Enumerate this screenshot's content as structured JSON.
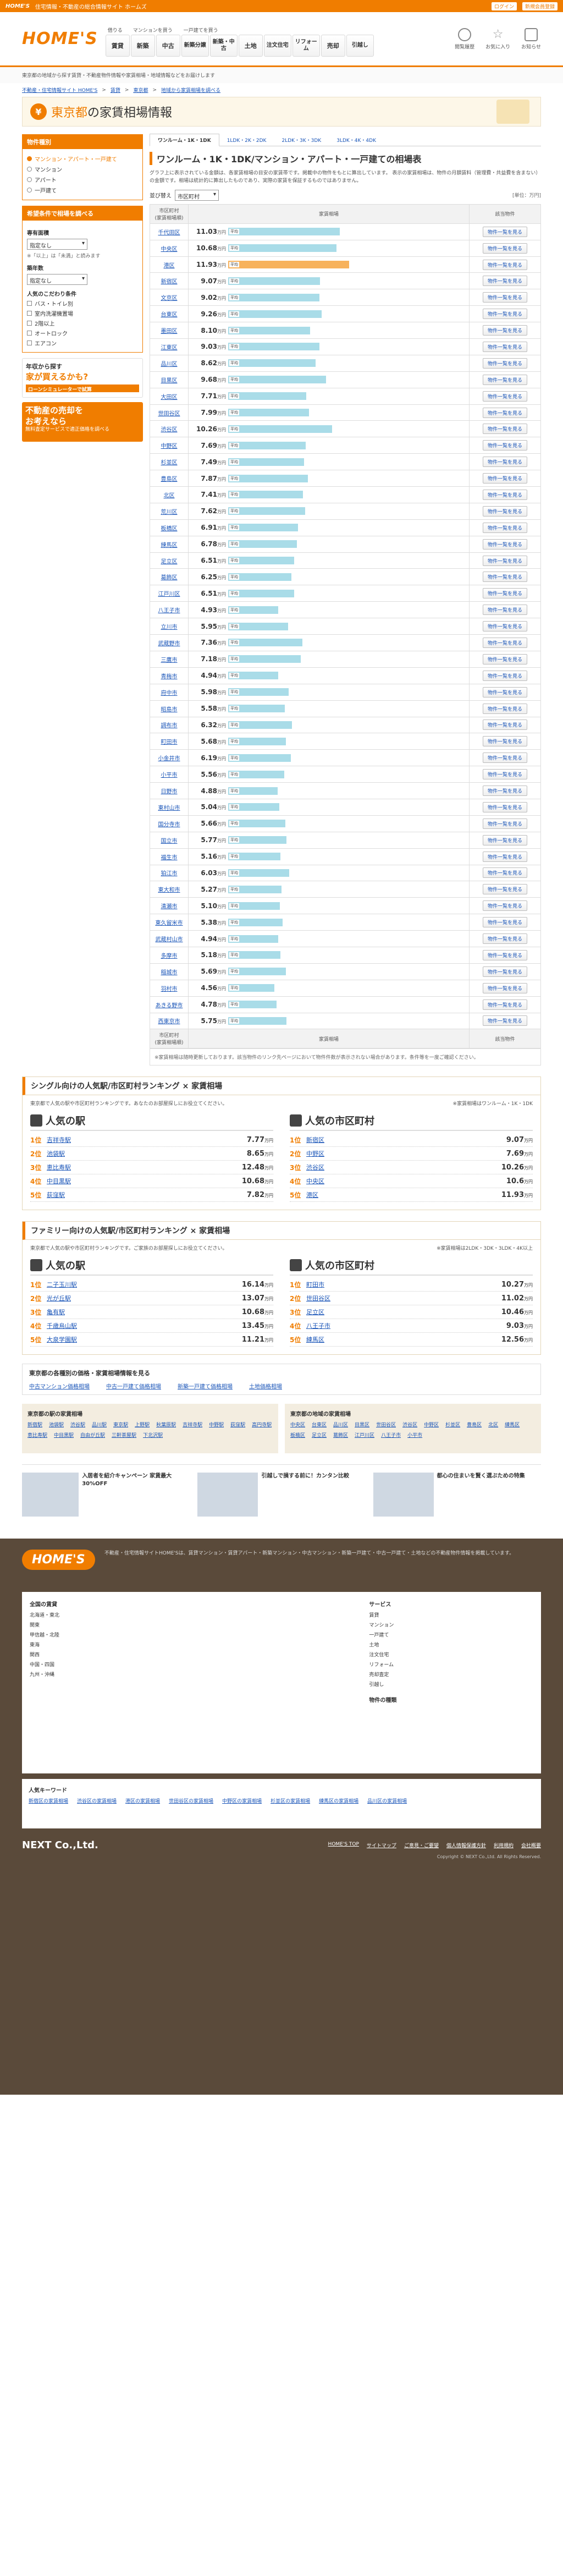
{
  "topbar": {
    "brand": "HOME'S",
    "tagline": "住宅情報・不動産の総合情報サイト ホームズ",
    "login": "ログイン",
    "register": "新規会員登録"
  },
  "header": {
    "logo": "HOME'S",
    "groups": [
      {
        "caption": "借りる",
        "buttons": [
          "賃貸"
        ]
      },
      {
        "caption": "マンションを買う",
        "buttons": [
          "新築",
          "中古"
        ]
      },
      {
        "caption": "一戸建てを買う",
        "buttons": [
          "新築分譲",
          "新築・中古"
        ]
      },
      {
        "caption": "",
        "buttons": [
          "土地",
          "注文住宅",
          "リフォーム",
          "売却",
          "引越し"
        ]
      }
    ],
    "icons": [
      "閲覧履歴",
      "お気に入り",
      "お知らせ"
    ]
  },
  "breadcrumb": "東京都の地域から探す賃貸・不動産物件情報や家賃相場・地域情報などをお届けします",
  "crumbs": [
    "不動産・住宅情報サイト HOME'S",
    "賃貸",
    "東京都",
    "地域から家賃相場を調べる"
  ],
  "title": {
    "pre": "東京都",
    "post": "の家賃相場情報",
    "icon": "¥"
  },
  "sidebar": {
    "box1": {
      "head": "物件種別",
      "items": [
        "マンション・アパート・一戸建て",
        "マンション",
        "アパート",
        "一戸建て"
      ],
      "selected": 0
    },
    "box2": {
      "head": "希望条件で相場を調べる",
      "madori_label": "専有面積",
      "madori_val": "指定なし",
      "note": "※「以上」は「未満」と読みます",
      "chiku_label": "築年数",
      "chiku_val": "指定なし",
      "pop_label": "人気のこだわり条件",
      "conds": [
        "バス・トイレ別",
        "室内洗濯機置場",
        "2階以上",
        "オートロック",
        "エアコン"
      ]
    },
    "promo1": {
      "top": "年収から探す",
      "big": "家が買えるかも?",
      "bar": "ローンシミュレーターで試算"
    },
    "promo2": {
      "line1": "不動産の売却を",
      "line2": "お考えなら",
      "small": "無料査定サービスで適正価格を調べる"
    }
  },
  "main": {
    "tabs": [
      "ワンルーム・1K・1DK",
      "1LDK・2K・2DK",
      "2LDK・3K・3DK",
      "3LDK・4K・4DK"
    ],
    "page_title": "ワンルーム・1K・1DK/マンション・アパート・一戸建ての相場表",
    "desc": "グラフ上に表示されている金額は、各家賃相場の目安の家賃帯です。掲載中の物件をもとに算出しています。\n表示の家賃相場は、物件の月額賃料（管理費・共益費を含まない）の金額です。相場は統計的に算出したものであり、実際の家賃を保証するものではありません。",
    "sort_label": "並び替え",
    "sort_val": "市区町村",
    "unit_note": "[単位：万円]",
    "col_city": "市区町村",
    "col_city_sub": "(家賃相場順)",
    "col_val": "家賃相場",
    "col_act": "該当物件",
    "action_label": "物件一覧を見る",
    "tag": "平均",
    "unit": "万円",
    "rows": [
      {
        "name": "千代田区",
        "val": 11.03
      },
      {
        "name": "中央区",
        "val": 10.68
      },
      {
        "name": "港区",
        "val": 11.93,
        "hi": true
      },
      {
        "name": "新宿区",
        "val": 9.07
      },
      {
        "name": "文京区",
        "val": 9.02
      },
      {
        "name": "台東区",
        "val": 9.26
      },
      {
        "name": "墨田区",
        "val": 8.1
      },
      {
        "name": "江東区",
        "val": 9.03
      },
      {
        "name": "品川区",
        "val": 8.62
      },
      {
        "name": "目黒区",
        "val": 9.68
      },
      {
        "name": "大田区",
        "val": 7.71
      },
      {
        "name": "世田谷区",
        "val": 7.99
      },
      {
        "name": "渋谷区",
        "val": 10.26
      },
      {
        "name": "中野区",
        "val": 7.69
      },
      {
        "name": "杉並区",
        "val": 7.49
      },
      {
        "name": "豊島区",
        "val": 7.87
      },
      {
        "name": "北区",
        "val": 7.41
      },
      {
        "name": "荒川区",
        "val": 7.62
      },
      {
        "name": "板橋区",
        "val": 6.91
      },
      {
        "name": "練馬区",
        "val": 6.78
      },
      {
        "name": "足立区",
        "val": 6.51
      },
      {
        "name": "葛飾区",
        "val": 6.25
      },
      {
        "name": "江戸川区",
        "val": 6.51
      },
      {
        "name": "八王子市",
        "val": 4.93
      },
      {
        "name": "立川市",
        "val": 5.95
      },
      {
        "name": "武蔵野市",
        "val": 7.36
      },
      {
        "name": "三鷹市",
        "val": 7.18
      },
      {
        "name": "青梅市",
        "val": 4.94
      },
      {
        "name": "府中市",
        "val": 5.98
      },
      {
        "name": "昭島市",
        "val": 5.58
      },
      {
        "name": "調布市",
        "val": 6.32
      },
      {
        "name": "町田市",
        "val": 5.68
      },
      {
        "name": "小金井市",
        "val": 6.19
      },
      {
        "name": "小平市",
        "val": 5.56
      },
      {
        "name": "日野市",
        "val": 4.88
      },
      {
        "name": "東村山市",
        "val": 5.04
      },
      {
        "name": "国分寺市",
        "val": 5.66
      },
      {
        "name": "国立市",
        "val": 5.77
      },
      {
        "name": "福生市",
        "val": 5.16
      },
      {
        "name": "狛江市",
        "val": 6.03
      },
      {
        "name": "東大和市",
        "val": 5.27
      },
      {
        "name": "清瀬市",
        "val": 5.1
      },
      {
        "name": "東久留米市",
        "val": 5.38
      },
      {
        "name": "武蔵村山市",
        "val": 4.94
      },
      {
        "name": "多摩市",
        "val": 5.18
      },
      {
        "name": "稲城市",
        "val": 5.69
      },
      {
        "name": "羽村市",
        "val": 4.56
      },
      {
        "name": "あきる野市",
        "val": 4.78
      },
      {
        "name": "西東京市",
        "val": 5.75
      }
    ],
    "foot_note": "※家賃相場は随時更新しております。該当物件のリンク先ページにおいて物件件数が表示されない場合があります。条件等を一度ご確認ください。"
  },
  "rank1": {
    "head": "シングル向けの人気駅/市区町村ランキング × 家賃相場",
    "desc": "東京都で人気の駅や市区町村ランキングです。あなたのお部屋探しにお役立てください。",
    "desc_r": "※家賃相場はワンルーム・1K・1DK",
    "station_title": "人気の駅",
    "city_title": "人気の市区町村",
    "stations": [
      {
        "n": "1位",
        "name": "吉祥寺駅",
        "v": "7.77"
      },
      {
        "n": "2位",
        "name": "池袋駅",
        "v": "8.65"
      },
      {
        "n": "3位",
        "name": "恵比寿駅",
        "v": "12.48"
      },
      {
        "n": "4位",
        "name": "中目黒駅",
        "v": "10.68"
      },
      {
        "n": "5位",
        "name": "荻窪駅",
        "v": "7.82"
      }
    ],
    "cities": [
      {
        "n": "1位",
        "name": "新宿区",
        "v": "9.07"
      },
      {
        "name": "中野区",
        "n": "2位",
        "v": "7.69"
      },
      {
        "n": "3位",
        "name": "渋谷区",
        "v": "10.26"
      },
      {
        "n": "4位",
        "name": "中央区",
        "v": "10.6"
      },
      {
        "n": "5位",
        "name": "港区",
        "v": "11.93"
      }
    ]
  },
  "rank2": {
    "head": "ファミリー向けの人気駅/市区町村ランキング × 家賃相場",
    "desc": "東京都で人気の駅や市区町村ランキングです。ご家族のお部屋探しにお役立てください。",
    "desc_r": "※家賃相場は2LDK・3DK・3LDK・4K以上",
    "station_title": "人気の駅",
    "city_title": "人気の市区町村",
    "stations": [
      {
        "n": "1位",
        "name": "二子玉川駅",
        "v": "16.14"
      },
      {
        "n": "2位",
        "name": "光が丘駅",
        "v": "13.07"
      },
      {
        "n": "3位",
        "name": "亀有駅",
        "v": "10.68"
      },
      {
        "n": "4位",
        "name": "千歳烏山駅",
        "v": "13.45"
      },
      {
        "n": "5位",
        "name": "大泉学園駅",
        "v": "11.21"
      }
    ],
    "cities": [
      {
        "n": "1位",
        "name": "町田市",
        "v": "10.27"
      },
      {
        "n": "2位",
        "name": "世田谷区",
        "v": "11.02"
      },
      {
        "n": "3位",
        "name": "足立区",
        "v": "10.46"
      },
      {
        "n": "4位",
        "name": "八王子市",
        "v": "9.03"
      },
      {
        "n": "5位",
        "name": "練馬区",
        "v": "12.56"
      }
    ],
    "unit": "万円"
  },
  "links": {
    "head": "東京都の各種別の価格・家賃相場情報を見る",
    "items": [
      "中古マンション価格相場",
      "中古一戸建て価格相場",
      "新築一戸建て価格相場",
      "土地価格相場"
    ]
  },
  "areas": [
    {
      "head": "東京都の駅の家賃相場",
      "items": [
        "新宿駅",
        "池袋駅",
        "渋谷駅",
        "品川駅",
        "東京駅",
        "上野駅",
        "秋葉原駅",
        "吉祥寺駅",
        "中野駅",
        "荻窪駅",
        "高円寺駅",
        "恵比寿駅",
        "中目黒駅",
        "自由が丘駅",
        "三軒茶屋駅",
        "下北沢駅"
      ]
    },
    {
      "head": "東京都の地域の家賃相場",
      "items": [
        "中央区",
        "台東区",
        "品川区",
        "目黒区",
        "世田谷区",
        "渋谷区",
        "中野区",
        "杉並区",
        "豊島区",
        "北区",
        "練馬区",
        "板橋区",
        "足立区",
        "葛飾区",
        "江戸川区",
        "八王子市",
        "小平市"
      ]
    }
  ],
  "banners": [
    {
      "text": "入居者を紹介キャンペーン 家賃最大30%OFF"
    },
    {
      "text": "引越しで損する前に！カンタン比較"
    },
    {
      "text": "都心の住まいを賢く選ぶための特集"
    }
  ],
  "footer": {
    "logo": "HOME'S",
    "desc": "不動産・住宅情報サイトHOME'Sは、賃貸マンション・賃貸アパート・新築マンション・中古マンション・新築一戸建て・中古一戸建て・土地などの不動産物件情報を掲載しています。",
    "list_head": "全国の賃貸",
    "service_head": "サービス",
    "other_head": "物件の種類",
    "regions": [
      "北海道・東北",
      "関東",
      "甲信越・北陸",
      "東海",
      "関西",
      "中国・四国",
      "九州・沖縄"
    ],
    "services": [
      "賃貸",
      "マンション",
      "一戸建て",
      "土地",
      "注文住宅",
      "リフォーム",
      "売却査定",
      "引越し"
    ],
    "kw_head": "人気キーワード",
    "kws": [
      "新宿区の家賃相場",
      "渋谷区の家賃相場",
      "港区の家賃相場",
      "世田谷区の家賃相場",
      "中野区の家賃相場",
      "杉並区の家賃相場",
      "練馬区の家賃相場",
      "品川区の家賃相場"
    ],
    "company": "NEXT Co.,Ltd.",
    "bot_links": [
      "HOME'S TOP",
      "サイトマップ",
      "ご意見・ご要望",
      "個人情報保護方針",
      "利用規約",
      "会社概要"
    ],
    "copyright": "Copyright © NEXT Co.,Ltd. All Rights Reserved."
  }
}
